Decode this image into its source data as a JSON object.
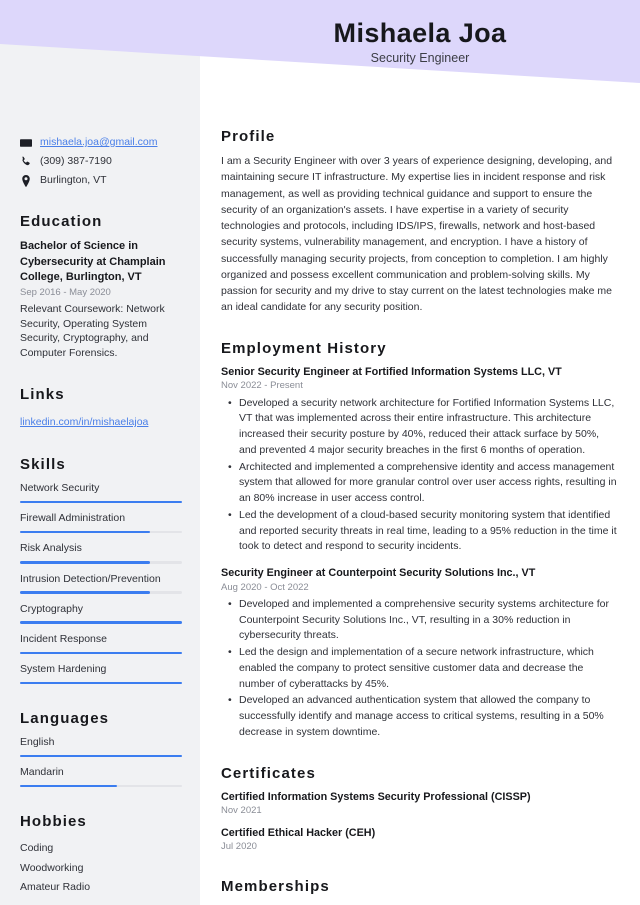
{
  "header": {
    "name": "Mishaela Joa",
    "role": "Security Engineer",
    "band_color": "#ddd7fb"
  },
  "theme": {
    "accent": "#3b7df0",
    "link": "#4a7fe8",
    "sidebar_bg": "#f1f2f4",
    "text": "#2f3138",
    "muted": "#8a8d96"
  },
  "sidebar": {
    "contact": {
      "email": "mishaela.joa@gmail.com",
      "phone": "(309) 387-7190",
      "location": "Burlington, VT",
      "email_icon": "envelope-icon",
      "phone_icon": "phone-icon",
      "location_icon": "map-pin-icon"
    },
    "education": {
      "heading": "Education",
      "entries": [
        {
          "title": "Bachelor of Science in Cybersecurity at Champlain College, Burlington, VT",
          "date": "Sep 2016 - May 2020",
          "description": "Relevant Coursework: Network Security, Operating System Security, Cryptography, and Computer Forensics."
        }
      ]
    },
    "links": {
      "heading": "Links",
      "items": [
        {
          "label": "linkedin.com/in/mishaelajoa"
        }
      ]
    },
    "skills": {
      "heading": "Skills",
      "items": [
        {
          "label": "Network Security",
          "level": 100
        },
        {
          "label": "Firewall Administration",
          "level": 80
        },
        {
          "label": "Risk Analysis",
          "level": 80
        },
        {
          "label": "Intrusion Detection/Prevention",
          "level": 80
        },
        {
          "label": "Cryptography",
          "level": 100
        },
        {
          "label": "Incident Response",
          "level": 100
        },
        {
          "label": "System Hardening",
          "level": 100
        }
      ]
    },
    "languages": {
      "heading": "Languages",
      "items": [
        {
          "label": "English",
          "level": 100
        },
        {
          "label": "Mandarin",
          "level": 60
        }
      ]
    },
    "hobbies": {
      "heading": "Hobbies",
      "items": [
        {
          "label": "Coding"
        },
        {
          "label": "Woodworking"
        },
        {
          "label": "Amateur Radio"
        }
      ]
    }
  },
  "main": {
    "profile": {
      "heading": "Profile",
      "text": "I am a Security Engineer with over 3 years of experience designing, developing, and maintaining secure IT infrastructure. My expertise lies in incident response and risk management, as well as providing technical guidance and support to ensure the security of an organization's assets. I have expertise in a variety of security technologies and protocols, including IDS/IPS, firewalls, network and host-based security systems, vulnerability management, and encryption. I have a history of successfully managing security projects, from conception to completion. I am highly organized and possess excellent communication and problem-solving skills. My passion for security and my drive to stay current on the latest technologies make me an ideal candidate for any security position."
    },
    "employment": {
      "heading": "Employment History",
      "jobs": [
        {
          "title": "Senior Security Engineer at Fortified Information Systems LLC, VT",
          "date": "Nov 2022 - Present",
          "bullets": [
            "Developed a security network architecture for Fortified Information Systems LLC, VT that was implemented across their entire infrastructure. This architecture increased their security posture by 40%, reduced their attack surface by 50%, and prevented 4 major security breaches in the first 6 months of operation.",
            "Architected and implemented a comprehensive identity and access management system that allowed for more granular control over user access rights, resulting in an 80% increase in user access control.",
            "Led the development of a cloud-based security monitoring system that identified and reported security threats in real time, leading to a 95% reduction in the time it took to detect and respond to security incidents."
          ]
        },
        {
          "title": "Security Engineer at Counterpoint Security Solutions Inc., VT",
          "date": "Aug 2020 - Oct 2022",
          "bullets": [
            "Developed and implemented a comprehensive security systems architecture for Counterpoint Security Solutions Inc., VT, resulting in a 30% reduction in cybersecurity threats.",
            "Led the design and implementation of a secure network infrastructure, which enabled the company to protect sensitive customer data and decrease the number of cyberattacks by 45%.",
            "Developed an advanced authentication system that allowed the company to successfully identify and manage access to critical systems, resulting in a 50% decrease in system downtime."
          ]
        }
      ]
    },
    "certificates": {
      "heading": "Certificates",
      "items": [
        {
          "title": "Certified Information Systems Security Professional (CISSP)",
          "date": "Nov 2021"
        },
        {
          "title": "Certified Ethical Hacker (CEH)",
          "date": "Jul 2020"
        }
      ]
    },
    "memberships": {
      "heading": "Memberships"
    }
  }
}
